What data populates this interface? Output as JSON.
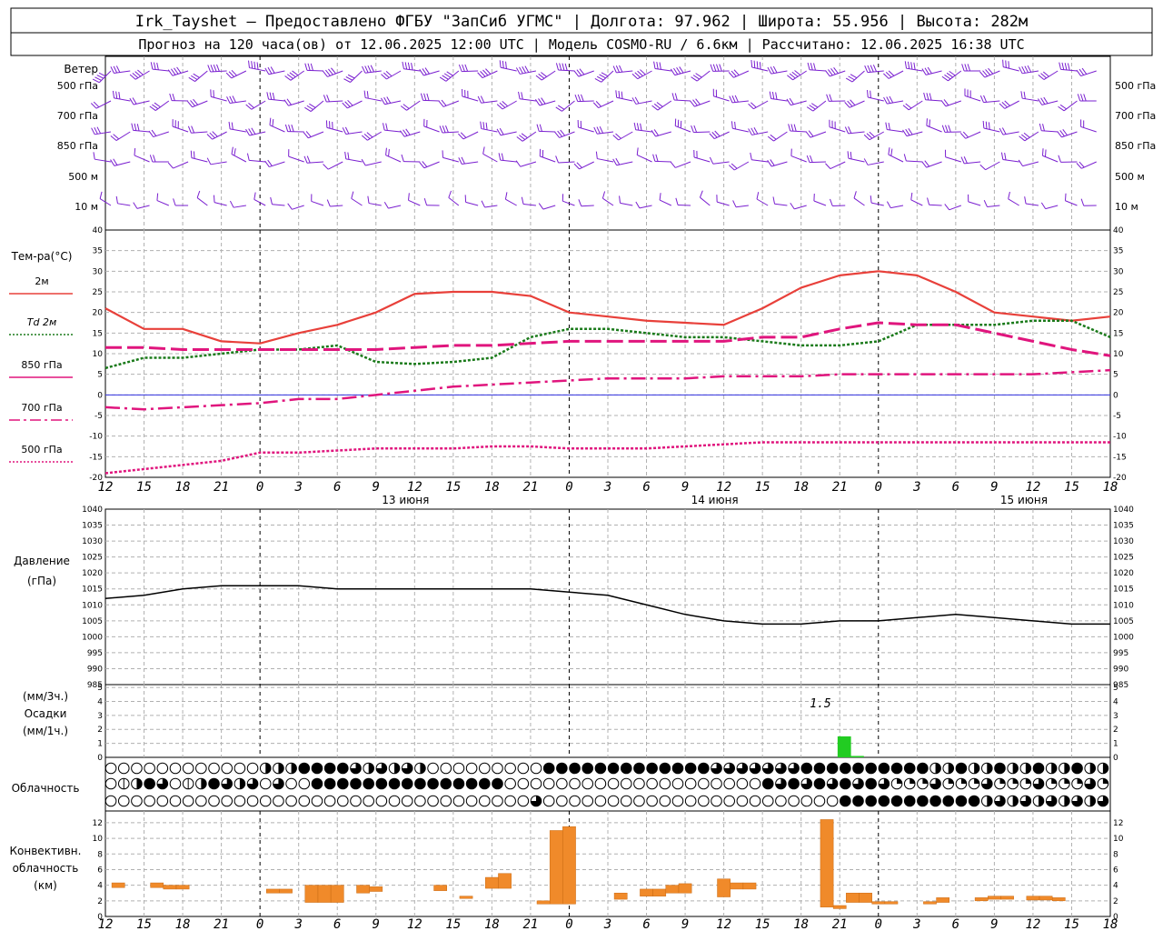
{
  "header": {
    "line1": "Irk_Tayshet — Предоставлено ФГБУ \"ЗапСиб УГМС\" | Долгота: 97.962 | Широта: 55.956 | Высота: 282м",
    "line2": "Прогноз на 120 часа(ов) от 12.06.2025 12:00 UTC  | Модель COSMO-RU / 6.6км | Рассчитано: 12.06.2025 16:38 UTC"
  },
  "panels": {
    "wind": {
      "title": "Ветер",
      "levels": [
        "500 гПа",
        "700 гПа",
        "850 гПа",
        "500 м",
        "10 м"
      ]
    },
    "temp": {
      "title": "Тем-ра(°C)",
      "legend": [
        "2м",
        "Td 2м",
        "850 гПа",
        "700 гПа",
        "500 гПа"
      ],
      "yticks": [
        40,
        35,
        30,
        25,
        20,
        15,
        10,
        5,
        0,
        -5,
        -10,
        -15,
        -20
      ]
    },
    "pressure": {
      "title": "Давление",
      "unit": "(гПа)",
      "yticks": [
        1040,
        1035,
        1030,
        1025,
        1020,
        1015,
        1010,
        1005,
        1000,
        995,
        990,
        985
      ]
    },
    "precip": {
      "label1": "(мм/3ч.)",
      "label2": "Осадки",
      "label3": "(мм/1ч.)",
      "yticks": [
        5,
        4,
        3,
        2,
        1,
        0
      ],
      "annotation": "1.5"
    },
    "cloud": {
      "title": "Облачность"
    },
    "conv": {
      "label1": "Конвективн.",
      "label2": "облачность",
      "label3": "(км)",
      "yticks": [
        12,
        10,
        8,
        6,
        4,
        2,
        0
      ]
    }
  },
  "xaxis": {
    "hour_labels": [
      "12",
      "15",
      "18",
      "21",
      "0",
      "3",
      "6",
      "9",
      "12",
      "15",
      "18",
      "21",
      "0",
      "3",
      "6",
      "9",
      "12",
      "15",
      "18",
      "21",
      "0",
      "3",
      "6",
      "9",
      "12",
      "15",
      "18"
    ],
    "day_labels": [
      "13 июня",
      "14 июня",
      "15 июня"
    ]
  },
  "colors": {
    "t2m": "#e8403a",
    "td2m": "#1a7a1a",
    "t850": "#e0157d",
    "t700": "#e0157d",
    "t500": "#e0157d",
    "zero": "#3030e0",
    "wind": "#7a1fd0",
    "precip": "#22cc22",
    "conv": "#f08a2a"
  },
  "chart_data": [
    {
      "type": "line",
      "title": "Тем-ра(°C)",
      "ylim": [
        -20,
        40
      ],
      "x_hours": [
        0,
        3,
        6,
        9,
        12,
        15,
        18,
        21,
        24,
        27,
        30,
        33,
        36,
        39,
        42,
        45,
        48,
        51,
        54,
        57,
        60,
        63,
        66,
        69,
        72,
        75,
        78
      ],
      "series": [
        {
          "name": "2м",
          "values": [
            21,
            16,
            16,
            13,
            12.5,
            15,
            17,
            20,
            24.5,
            25,
            25,
            24,
            20,
            19,
            18,
            17.5,
            17,
            21,
            26,
            29,
            30,
            29,
            25,
            20,
            19,
            18,
            19
          ]
        },
        {
          "name": "Td 2м",
          "values": [
            6.5,
            9,
            9,
            10,
            11,
            11,
            12,
            8,
            7.5,
            8,
            9,
            14,
            16,
            16,
            15,
            14,
            14,
            13,
            12,
            12,
            13,
            17,
            17,
            17,
            18,
            18,
            14
          ]
        },
        {
          "name": "850 гПа",
          "values": [
            11.5,
            11.5,
            11,
            11,
            11,
            11,
            11,
            11,
            11.5,
            12,
            12,
            12.5,
            13,
            13,
            13,
            13,
            13,
            14,
            14,
            16,
            17.5,
            17,
            17,
            15,
            13,
            11,
            9.5
          ]
        },
        {
          "name": "700 гПа",
          "values": [
            -3,
            -3.5,
            -3,
            -2.5,
            -2,
            -1,
            -1,
            0,
            1,
            2,
            2.5,
            3,
            3.5,
            4,
            4,
            4,
            4.5,
            4.5,
            4.5,
            5,
            5,
            5,
            5,
            5,
            5,
            5.5,
            6
          ]
        },
        {
          "name": "500 гПа",
          "values": [
            -19,
            -18,
            -17,
            -16,
            -14,
            -14,
            -13.5,
            -13,
            -13,
            -13,
            -12.5,
            -12.5,
            -13,
            -13,
            -13,
            -12.5,
            -12,
            -11.5,
            -11.5,
            -11.5,
            -11.5,
            -11.5,
            -11.5,
            -11.5,
            -11.5,
            -11.5,
            -11.5
          ]
        }
      ]
    },
    {
      "type": "line",
      "title": "Давление",
      "ylim": [
        985,
        1040
      ],
      "x_hours": [
        0,
        3,
        6,
        9,
        12,
        15,
        18,
        21,
        24,
        27,
        30,
        33,
        36,
        39,
        42,
        45,
        48,
        51,
        54,
        57,
        60,
        63,
        66,
        69,
        72,
        75,
        78
      ],
      "series": [
        {
          "name": "Давление",
          "values": [
            1012,
            1013,
            1015,
            1016,
            1016,
            1016,
            1015,
            1015,
            1015,
            1015,
            1015,
            1015,
            1014,
            1013,
            1010,
            1007,
            1005,
            1004,
            1004,
            1005,
            1005,
            1006,
            1007,
            1006,
            1005,
            1004,
            1004
          ]
        }
      ]
    },
    {
      "type": "bar",
      "title": "Осадки",
      "ylim": [
        0,
        5
      ],
      "bars": [
        {
          "x_hour": 57,
          "value": 1.5
        },
        {
          "x_hour": 58,
          "value": 0.1
        }
      ]
    },
    {
      "type": "bar",
      "title": "Конвективн. облачность",
      "ylim": [
        0,
        13
      ],
      "bars": [
        {
          "x_hour": 1,
          "bottom": 3.7,
          "top": 4.3
        },
        {
          "x_hour": 4,
          "bottom": 3.7,
          "top": 4.3
        },
        {
          "x_hour": 5,
          "bottom": 3.5,
          "top": 4.0
        },
        {
          "x_hour": 6,
          "bottom": 3.5,
          "top": 4.0
        },
        {
          "x_hour": 13,
          "bottom": 3.0,
          "top": 3.5
        },
        {
          "x_hour": 14,
          "bottom": 3.0,
          "top": 3.5
        },
        {
          "x_hour": 16,
          "bottom": 1.8,
          "top": 4.0
        },
        {
          "x_hour": 17,
          "bottom": 1.8,
          "top": 4.0
        },
        {
          "x_hour": 18,
          "bottom": 1.8,
          "top": 4.0
        },
        {
          "x_hour": 20,
          "bottom": 3.0,
          "top": 4.0
        },
        {
          "x_hour": 21,
          "bottom": 3.2,
          "top": 3.8
        },
        {
          "x_hour": 26,
          "bottom": 3.3,
          "top": 4.0
        },
        {
          "x_hour": 28,
          "bottom": 2.3,
          "top": 2.6
        },
        {
          "x_hour": 30,
          "bottom": 3.6,
          "top": 5.0
        },
        {
          "x_hour": 31,
          "bottom": 3.6,
          "top": 5.5
        },
        {
          "x_hour": 34,
          "bottom": 1.6,
          "top": 2.0
        },
        {
          "x_hour": 35,
          "bottom": 1.6,
          "top": 11.0
        },
        {
          "x_hour": 36,
          "bottom": 1.6,
          "top": 11.5
        },
        {
          "x_hour": 40,
          "bottom": 2.2,
          "top": 3.0
        },
        {
          "x_hour": 42,
          "bottom": 2.6,
          "top": 3.5
        },
        {
          "x_hour": 43,
          "bottom": 2.6,
          "top": 3.5
        },
        {
          "x_hour": 44,
          "bottom": 3.0,
          "top": 4.0
        },
        {
          "x_hour": 45,
          "bottom": 3.0,
          "top": 4.2
        },
        {
          "x_hour": 48,
          "bottom": 2.5,
          "top": 4.8
        },
        {
          "x_hour": 49,
          "bottom": 3.5,
          "top": 4.3
        },
        {
          "x_hour": 50,
          "bottom": 3.5,
          "top": 4.3
        },
        {
          "x_hour": 56,
          "bottom": 1.2,
          "top": 12.4
        },
        {
          "x_hour": 57,
          "bottom": 1.0,
          "top": 1.4
        },
        {
          "x_hour": 58,
          "bottom": 1.8,
          "top": 3.0
        },
        {
          "x_hour": 59,
          "bottom": 1.8,
          "top": 3.0
        },
        {
          "x_hour": 60,
          "bottom": 1.6,
          "top": 1.9
        },
        {
          "x_hour": 61,
          "bottom": 1.6,
          "top": 1.9
        },
        {
          "x_hour": 64,
          "bottom": 1.6,
          "top": 1.9
        },
        {
          "x_hour": 65,
          "bottom": 1.8,
          "top": 2.4
        },
        {
          "x_hour": 68,
          "bottom": 2.0,
          "top": 2.4
        },
        {
          "x_hour": 69,
          "bottom": 2.2,
          "top": 2.6
        },
        {
          "x_hour": 70,
          "bottom": 2.2,
          "top": 2.6
        },
        {
          "x_hour": 72,
          "bottom": 2.1,
          "top": 2.6
        },
        {
          "x_hour": 73,
          "bottom": 2.1,
          "top": 2.6
        },
        {
          "x_hour": 74,
          "bottom": 2.0,
          "top": 2.4
        }
      ]
    }
  ]
}
